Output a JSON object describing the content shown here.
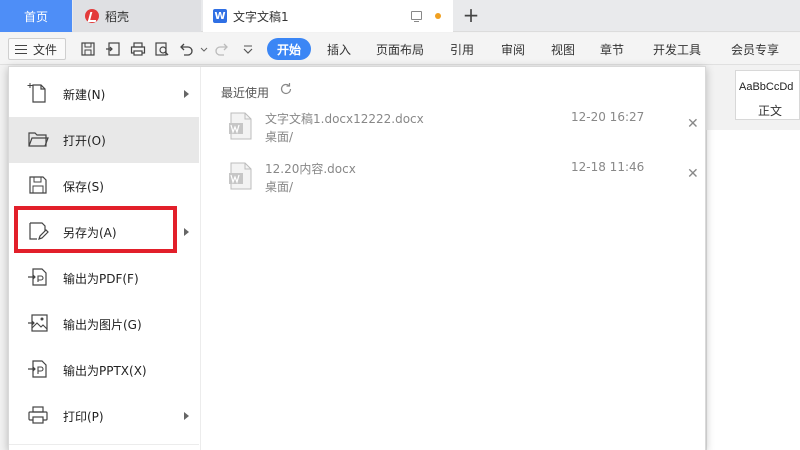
{
  "tabs": {
    "home": "首页",
    "daoke": "稻壳",
    "doc": "文字文稿1",
    "doc_logo": "W",
    "plus": "+"
  },
  "toolbar": {
    "file_label": "文件",
    "ribbon_tabs": [
      "开始",
      "插入",
      "页面布局",
      "引用",
      "审阅",
      "视图",
      "章节",
      "开发工具",
      "会员专享"
    ],
    "active_tab": "开始"
  },
  "style_panel": {
    "sample": "AaBbCcDd",
    "name": "正文"
  },
  "file_menu": {
    "items": [
      {
        "label": "新建(N)",
        "icon": "new-file-icon",
        "has_arrow": true
      },
      {
        "label": "打开(O)",
        "icon": "folder-open-icon",
        "has_arrow": false
      },
      {
        "label": "保存(S)",
        "icon": "save-icon",
        "has_arrow": false
      },
      {
        "label": "另存为(A)",
        "icon": "save-as-icon",
        "has_arrow": true
      },
      {
        "label": "输出为PDF(F)",
        "icon": "export-pdf-icon",
        "has_arrow": false
      },
      {
        "label": "输出为图片(G)",
        "icon": "export-image-icon",
        "has_arrow": false
      },
      {
        "label": "输出为PPTX(X)",
        "icon": "export-pptx-icon",
        "has_arrow": false
      },
      {
        "label": "打印(P)",
        "icon": "print-icon",
        "has_arrow": true
      }
    ],
    "selected": "打开(O)",
    "highlighted": "另存为(A)"
  },
  "recent": {
    "title": "最近使用",
    "files": [
      {
        "name": "文字文稿1.docx12222.docx",
        "path": "桌面/",
        "date": "12-20 16:27"
      },
      {
        "name": "12.20内容.docx",
        "path": "桌面/",
        "date": "12-18 11:46"
      }
    ],
    "close_glyph": "✕"
  },
  "colors": {
    "accent": "#3b86f5",
    "home_tab": "#4e8ef7",
    "highlight": "#e21f2a"
  }
}
